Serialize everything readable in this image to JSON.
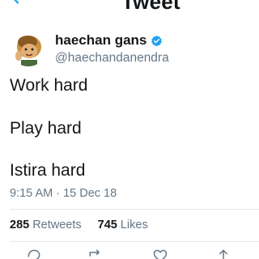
{
  "header": {
    "title": "Tweet"
  },
  "author": {
    "display_name": "haechan gans",
    "handle": "@haechandanendra",
    "verified": true,
    "verified_color": "#1da1f2"
  },
  "tweet": {
    "lines": [
      "Work hard",
      "Play hard",
      "Istira hard"
    ],
    "timestamp": "9:15 AM · 15 Dec 18"
  },
  "stats": {
    "retweets_count": "285",
    "retweets_label": "Retweets",
    "likes_count": "745",
    "likes_label": "Likes"
  },
  "actions": {
    "icons": [
      "reply-icon",
      "retweet-icon",
      "like-icon",
      "share-icon"
    ]
  },
  "colors": {
    "text_primary": "#14171a",
    "text_secondary": "#657786",
    "divider": "#e1e8ed"
  }
}
